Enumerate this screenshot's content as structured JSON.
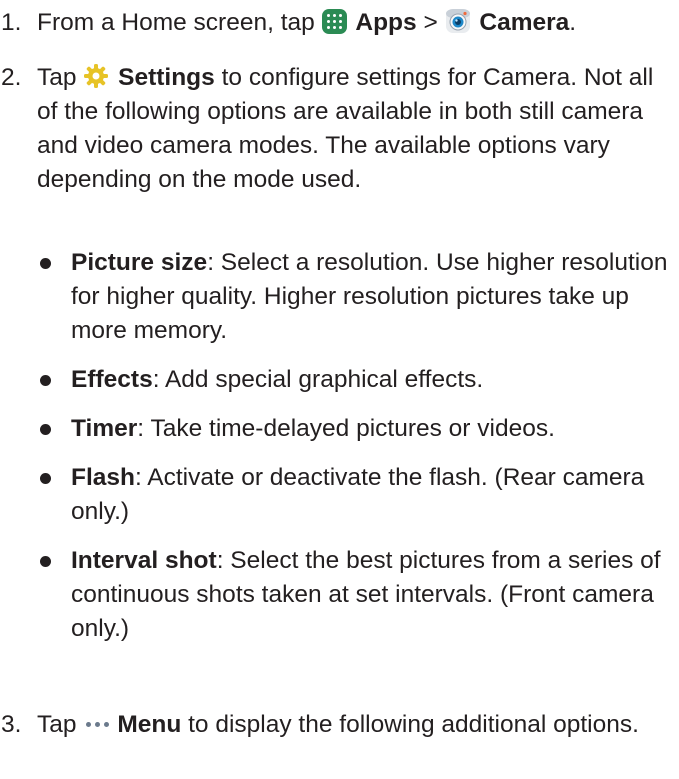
{
  "steps": [
    {
      "number": "1.",
      "t1": "From a Home screen, tap ",
      "apps_label": "Apps",
      "sep": " > ",
      "camera_label": "Camera",
      "t2": "."
    },
    {
      "number": "2.",
      "t1": "Tap ",
      "settings_label": "Settings",
      "t2": " to configure settings for Camera. Not all of the following options are available in both still camera and video camera modes. The available options vary depending on the mode used.",
      "bullets": [
        {
          "term": "Picture size",
          "desc": ": Select a resolution. Use higher resolution for higher quality. Higher resolution pictures take up more memory."
        },
        {
          "term": "Effects",
          "desc": ": Add special graphical effects."
        },
        {
          "term": "Timer",
          "desc": ": Take time-delayed pictures or videos."
        },
        {
          "term": "Flash",
          "desc": ": Activate or deactivate the flash. (Rear camera only.)"
        },
        {
          "term": "Interval shot",
          "desc": ": Select the best pictures from a series of continuous shots taken at set intervals. (Front camera only.)"
        }
      ]
    },
    {
      "number": "3.",
      "t1": "Tap ",
      "menu_label": "Menu",
      "t2": " to display the following additional options."
    }
  ],
  "icons": {
    "apps": "apps-grid-icon",
    "camera": "camera-icon",
    "settings": "gear-icon",
    "menu": "more-dots-icon"
  },
  "colors": {
    "text": "#231f20",
    "apps_icon": "#2b8b54",
    "settings_icon": "#e7c327",
    "menu_dots": "#6b7a8c"
  }
}
